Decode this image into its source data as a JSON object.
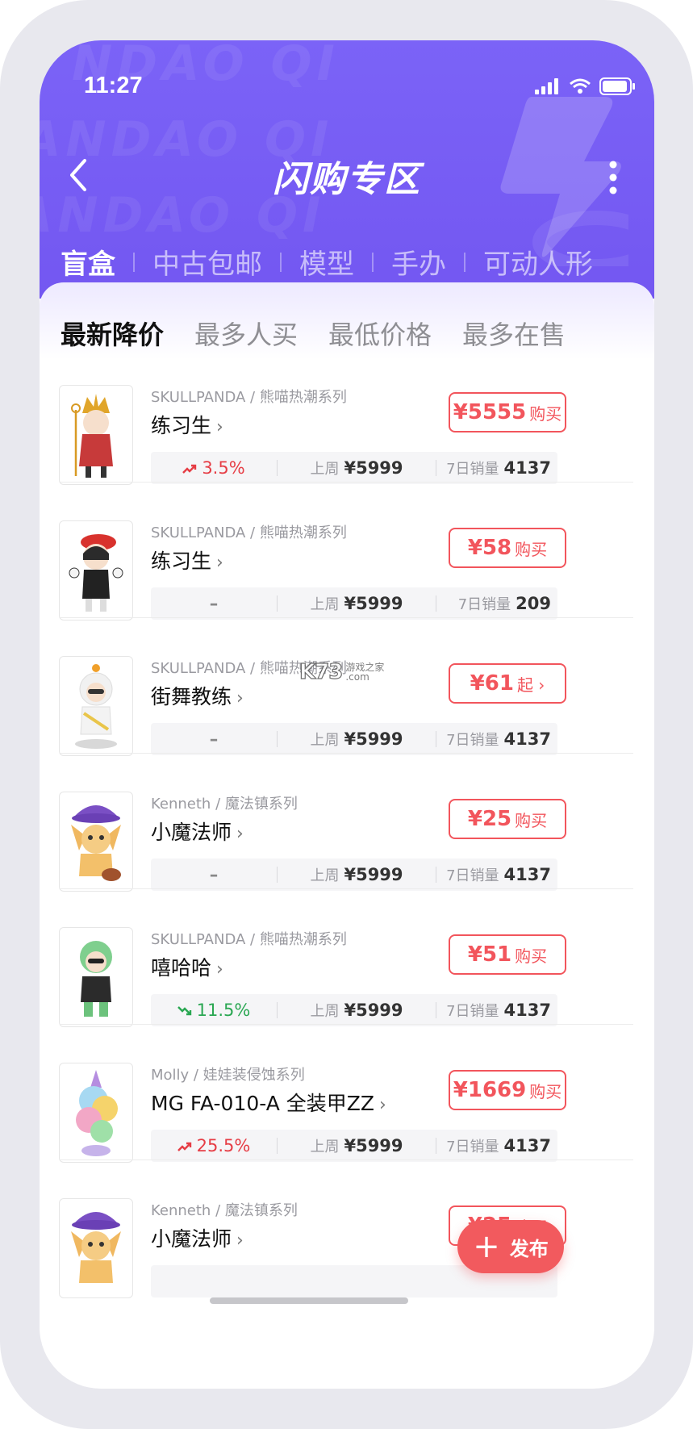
{
  "status_bar": {
    "time": "11:27"
  },
  "header": {
    "title": "闪购专区"
  },
  "category_tabs": [
    "盲盒",
    "中古包邮",
    "模型",
    "手办",
    "可动人形"
  ],
  "sort_tabs": [
    "最新降价",
    "最多人买",
    "最低价格",
    "最多在售"
  ],
  "labels": {
    "last_week": "上周",
    "sales_7d": "7日销量"
  },
  "items": [
    {
      "brand": "SKULLPANDA",
      "series": "熊喵热潮系列",
      "name": "练习生",
      "price": "¥5555",
      "action": "购买",
      "change": "3.5%",
      "trend": "up",
      "last_week_price": "¥5999",
      "sales": "4137"
    },
    {
      "brand": "SKULLPANDA",
      "series": "熊喵热潮系列",
      "name": "练习生",
      "price": "¥58",
      "action": "购买",
      "change": "–",
      "trend": "flat",
      "last_week_price": "¥5999",
      "sales": "209"
    },
    {
      "brand": "SKULLPANDA",
      "series": "熊喵热潮系列",
      "name": "街舞教练",
      "price": "¥61",
      "action": "起 ›",
      "change": "–",
      "trend": "flat",
      "last_week_price": "¥5999",
      "sales": "4137"
    },
    {
      "brand": "Kenneth",
      "series": "魔法镇系列",
      "name": "小魔法师",
      "price": "¥25",
      "action": "购买",
      "change": "–",
      "trend": "flat",
      "last_week_price": "¥5999",
      "sales": "4137"
    },
    {
      "brand": "SKULLPANDA",
      "series": "熊喵热潮系列",
      "name": "嘻哈哈",
      "price": "¥51",
      "action": "购买",
      "change": "11.5%",
      "trend": "down",
      "last_week_price": "¥5999",
      "sales": "4137"
    },
    {
      "brand": "Molly",
      "series": "娃娃装侵蚀系列",
      "name": "MG FA-010-A 全装甲ZZ",
      "price": "¥1669",
      "action": "购买",
      "change": "25.5%",
      "trend": "up",
      "last_week_price": "¥5999",
      "sales": "4137"
    },
    {
      "brand": "Kenneth",
      "series": "魔法镇系列",
      "name": "小魔法师",
      "price": "¥25",
      "action": "购买",
      "change": "",
      "trend": "flat",
      "last_week_price": "",
      "sales": ""
    }
  ],
  "publish": {
    "label": "发布"
  },
  "watermark": {
    "logo": "K73",
    "tag1": "游戏之家",
    "tag2": ".com"
  },
  "colors": {
    "header": "#7357f1",
    "accent": "#f2555c",
    "up": "#e63d45",
    "down": "#2aa752"
  }
}
